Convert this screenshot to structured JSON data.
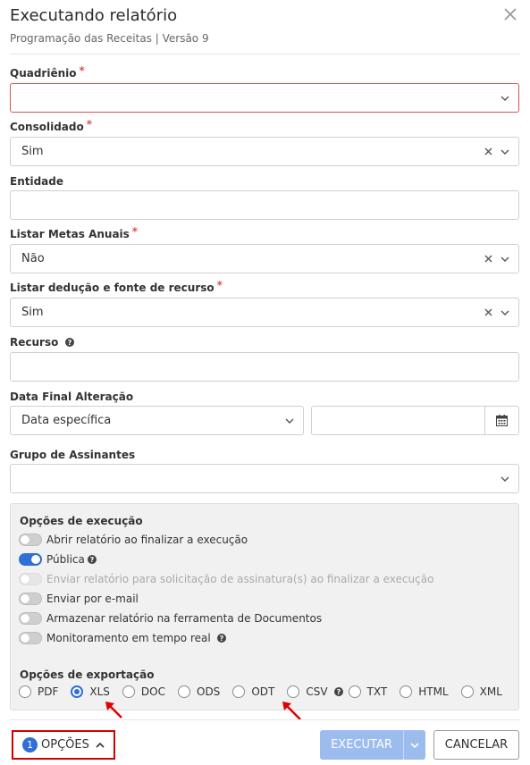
{
  "header": {
    "title": "Executando relatório",
    "subtitle": "Programação das Receitas | Versão 9"
  },
  "fields": {
    "quadrienio": {
      "label": "Quadriênio",
      "value": ""
    },
    "consolidado": {
      "label": "Consolidado",
      "value": "Sim"
    },
    "entidade": {
      "label": "Entidade",
      "value": ""
    },
    "listar_metas": {
      "label": "Listar Metas Anuais",
      "value": "Não"
    },
    "listar_deducao": {
      "label": "Listar dedução e fonte de recurso",
      "value": "Sim"
    },
    "recurso": {
      "label": "Recurso",
      "value": ""
    },
    "data_final": {
      "label": "Data Final Alteração",
      "select_value": "Data específica",
      "date_value": ""
    },
    "grupo_assinantes": {
      "label": "Grupo de Assinantes",
      "value": ""
    }
  },
  "execution_options": {
    "title": "Opções de execução",
    "items": [
      {
        "label": "Abrir relatório ao finalizar a execução",
        "state": "off"
      },
      {
        "label": "Pública",
        "state": "on"
      },
      {
        "label": "Enviar relatório para solicitação de assinatura(s) ao finalizar a execução",
        "state": "disabled"
      },
      {
        "label": "Enviar por e-mail",
        "state": "off"
      },
      {
        "label": "Armazenar relatório na ferramenta de Documentos",
        "state": "off"
      },
      {
        "label": "Monitoramento em tempo real",
        "state": "off"
      }
    ]
  },
  "export_options": {
    "title": "Opções de exportação",
    "formats": [
      "PDF",
      "XLS",
      "DOC",
      "ODS",
      "ODT",
      "CSV",
      "TXT",
      "HTML",
      "XML"
    ],
    "selected": "XLS"
  },
  "footer": {
    "options_badge": "1",
    "options_label": "OPÇÕES",
    "execute_label": "EXECUTAR",
    "cancel_label": "CANCELAR"
  },
  "colors": {
    "accent": "#2f6fd6",
    "error": "#d9534f",
    "highlight": "#d40000"
  }
}
